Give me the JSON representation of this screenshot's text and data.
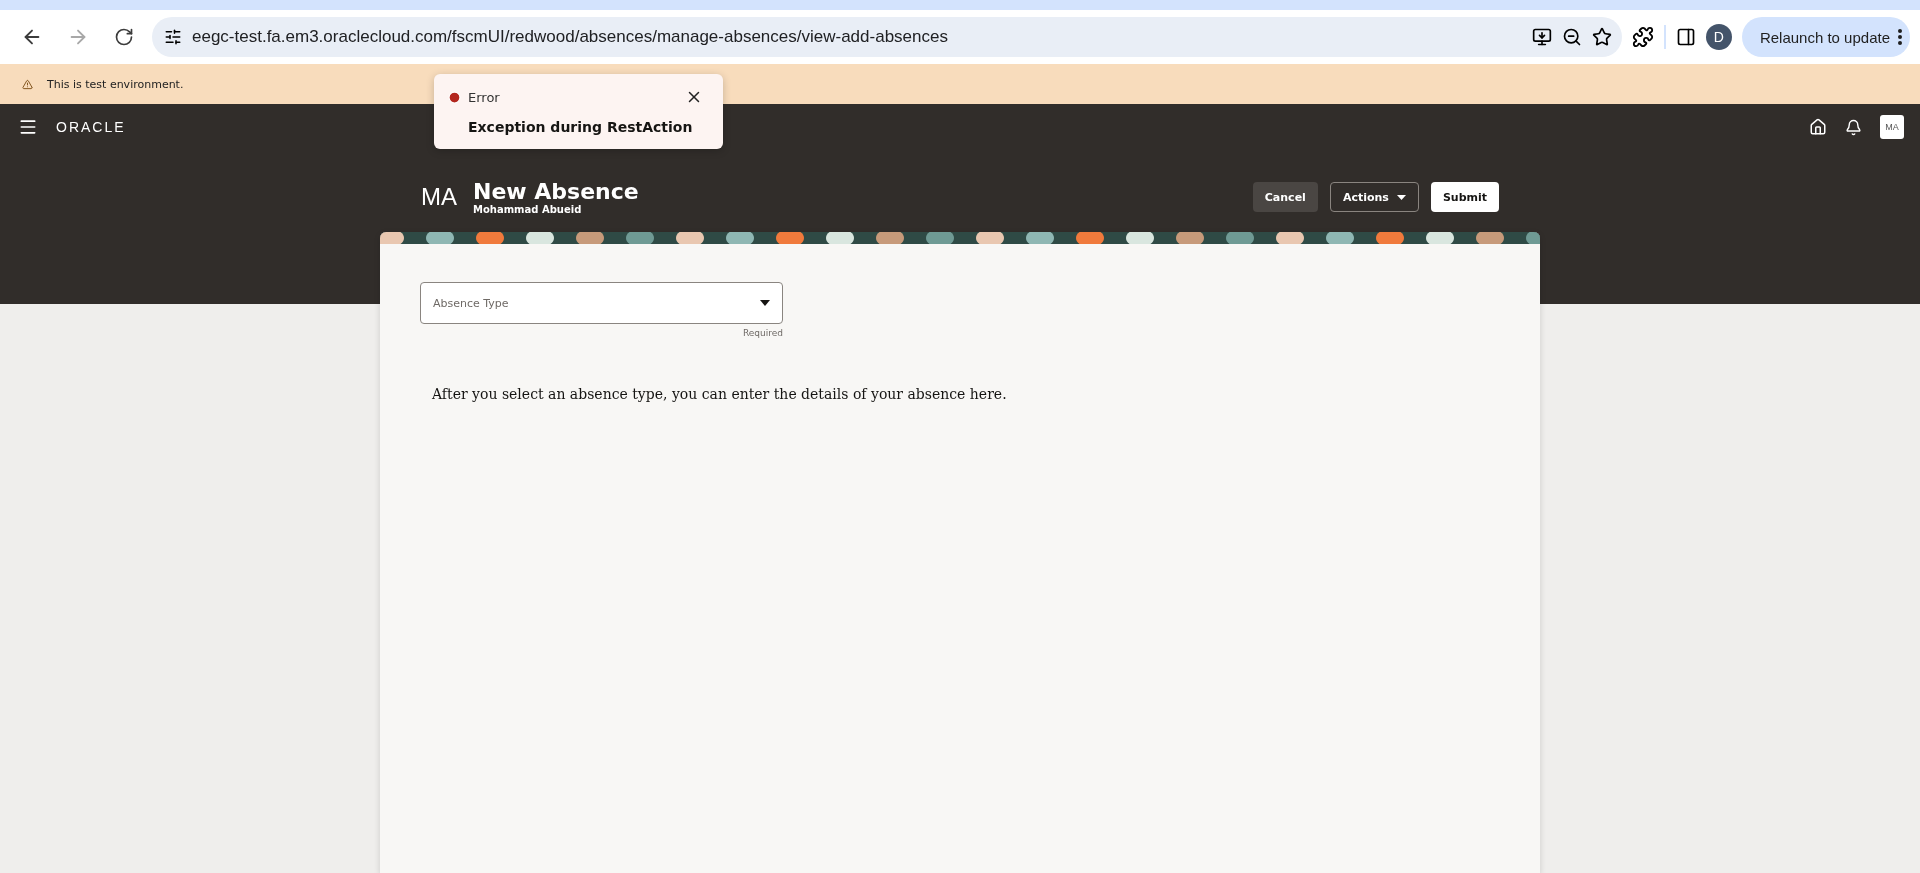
{
  "browser": {
    "url": "eegc-test.fa.em3.oraclecloud.com/fscmUI/redwood/absences/manage-absences/view-add-absences",
    "profile_initial": "D",
    "relaunch_label": "Relaunch to update"
  },
  "env_banner": {
    "text": "This is test environment."
  },
  "toast": {
    "title": "Error",
    "message": "Exception during RestAction"
  },
  "app_bar": {
    "logo": "ORACLE",
    "user_initials": "MA"
  },
  "page_header": {
    "initials": "MA",
    "title": "New Absence",
    "subtitle": "Mohammad Abueid",
    "buttons": [
      {
        "label": "Cancel",
        "kind": "secondary"
      },
      {
        "label": "Actions",
        "kind": "menu"
      },
      {
        "label": "Submit",
        "kind": "primary"
      }
    ]
  },
  "form": {
    "absence_type": {
      "placeholder": "Absence Type",
      "helper": "Required"
    },
    "info": "After you select an absence type, you can enter the details of your absence here."
  }
}
